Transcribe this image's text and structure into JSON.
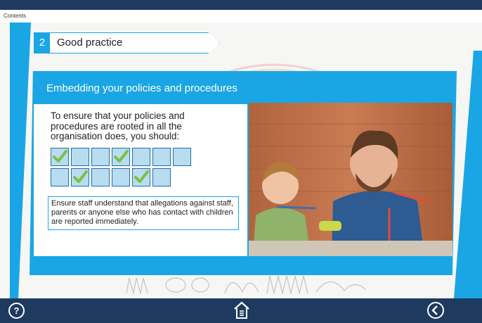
{
  "nav": {
    "contents_label": "Contents"
  },
  "section": {
    "number": "2",
    "title": "Good practice"
  },
  "card": {
    "title": "Embedding your policies and procedures",
    "intro": "To ensure that your policies and procedures are rooted in all the organisation does, you should:",
    "answer": "Ensure staff understand that allegations against staff, parents or anyone else who has contact with children are reported immediately."
  },
  "grid": [
    [
      true,
      false,
      false,
      true,
      false,
      false,
      false
    ],
    [
      false,
      true,
      false,
      false,
      true,
      false
    ]
  ],
  "footer": {
    "help_label": "?"
  },
  "colors": {
    "accent": "#1aa6e4",
    "navy": "#1e3a5f",
    "check": "#7ac143",
    "cell": "#b9dcf1"
  },
  "icons": {
    "help": "question-icon",
    "home": "home-icon",
    "back": "back-arrow-icon",
    "check": "check-icon"
  }
}
